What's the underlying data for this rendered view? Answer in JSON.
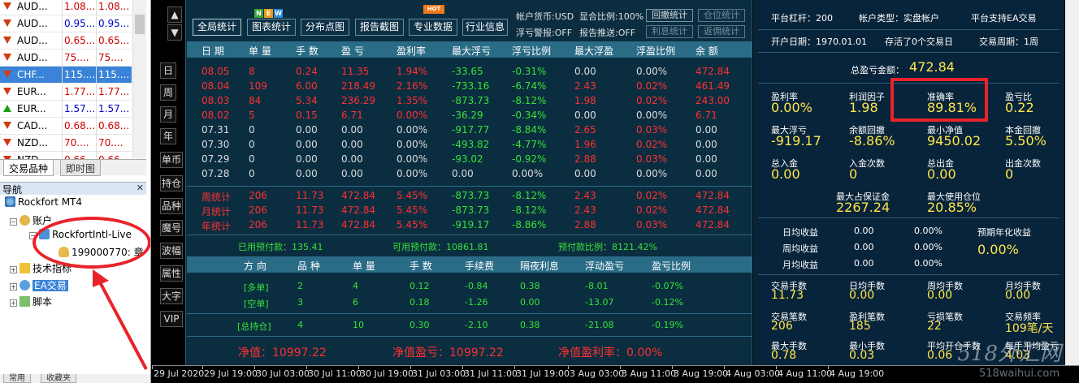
{
  "market_watch": {
    "rows": [
      {
        "symbol": "AUD...",
        "bid": "1.08...",
        "ask": "1.08...",
        "dir": "down",
        "color": "red"
      },
      {
        "symbol": "AUD...",
        "bid": "0.95...",
        "ask": "0.95...",
        "dir": "down",
        "color": "blue"
      },
      {
        "symbol": "AUD...",
        "bid": "0.65...",
        "ask": "0.65...",
        "dir": "down",
        "color": "red"
      },
      {
        "symbol": "AUD...",
        "bid": "75....",
        "ask": "75....",
        "dir": "down",
        "color": "red"
      },
      {
        "symbol": "CHF...",
        "bid": "115....",
        "ask": "115....",
        "dir": "down",
        "color": "sel"
      },
      {
        "symbol": "EUR...",
        "bid": "1.77...",
        "ask": "1.77...",
        "dir": "down",
        "color": "red"
      },
      {
        "symbol": "EUR...",
        "bid": "1.57...",
        "ask": "1.57...",
        "dir": "up",
        "color": "blue"
      },
      {
        "symbol": "CAD...",
        "bid": "0.68...",
        "ask": "0.68...",
        "dir": "down",
        "color": "red"
      },
      {
        "symbol": "NZD...",
        "bid": "70....",
        "ask": "70....",
        "dir": "down",
        "color": "red"
      },
      {
        "symbol": "NZD",
        "bid": "0.66",
        "ask": "0.66",
        "dir": "down",
        "color": "red"
      }
    ],
    "tabs": [
      "交易品种",
      "即时图"
    ]
  },
  "navigator": {
    "title": "导航",
    "root": "Rockfort MT4",
    "accounts": "账户",
    "server": "RockfortIntl-Live",
    "account": "199000770: 章",
    "indicators": "技术指标",
    "ea": "EA交易",
    "scripts": "脚本",
    "bottom_tabs": [
      "常用",
      "收藏夹"
    ]
  },
  "side_buttons": {
    "up": "▲",
    "down": "▼",
    "items": [
      "日",
      "周",
      "月",
      "年",
      "单币",
      "持仓",
      "品种",
      "魔号",
      "波幅",
      "属性",
      "大字",
      "VIP"
    ]
  },
  "toolbar": {
    "buttons": [
      "全局统计",
      "图表统计",
      "分布点图",
      "报告截图",
      "专业数据",
      "行业信息"
    ],
    "new_badges": [
      "N",
      "E",
      "W"
    ],
    "hot": "HOT",
    "currency": "帐户货币:USD",
    "show_ratio": "显合比例:100%",
    "float_alarm": "浮亏警报:OFF",
    "report_push": "报告推送:OFF",
    "btn_drawdown": "回撤统计",
    "btn_position": "仓位统计",
    "btn_interest": "利息统计",
    "btn_rebate": "返佣统计"
  },
  "table1": {
    "headers": [
      "日 期",
      "单 量",
      "手 数",
      "盈 亏",
      "盈利率",
      "最大浮亏",
      "浮亏比例",
      "最大浮盈",
      "浮盈比例",
      "余 额"
    ],
    "rows": [
      {
        "c": "r",
        "v": [
          "08.05",
          "8",
          "0.24",
          "11.35",
          "1.94%",
          "-33.65",
          "-0.31%",
          "0.00",
          "0.00%",
          "472.84"
        ]
      },
      {
        "c": "r",
        "v": [
          "08.04",
          "109",
          "6.00",
          "218.49",
          "2.16%",
          "-733.16",
          "-6.74%",
          "2.43",
          "0.02%",
          "461.49"
        ]
      },
      {
        "c": "r",
        "v": [
          "08.03",
          "84",
          "5.34",
          "236.29",
          "1.35%",
          "-873.73",
          "-8.12%",
          "1.98",
          "0.02%",
          "243.00"
        ]
      },
      {
        "c": "r",
        "v": [
          "08.02",
          "5",
          "0.15",
          "6.71",
          "0.00%",
          "-36.29",
          "-0.34%",
          "0.00",
          "0.00%",
          "6.71"
        ]
      },
      {
        "c": "w",
        "v": [
          "07.31",
          "0",
          "0.00",
          "0.00",
          "0.00%",
          "-917.77",
          "-8.84%",
          "2.65",
          "0.03%",
          "0.00"
        ]
      },
      {
        "c": "w",
        "v": [
          "07.30",
          "0",
          "0.00",
          "0.00",
          "0.00%",
          "-493.82",
          "-4.77%",
          "1.96",
          "0.02%",
          "0.00"
        ]
      },
      {
        "c": "w",
        "v": [
          "07.29",
          "0",
          "0.00",
          "0.00",
          "0.00%",
          "-93.02",
          "-0.92%",
          "2.88",
          "0.03%",
          "0.00"
        ]
      },
      {
        "c": "w",
        "v": [
          "07.28",
          "0",
          "0.00",
          "0.00",
          "0.00%",
          "0.00",
          "0.00%",
          "0.00",
          "0.00%",
          "0.00"
        ]
      }
    ],
    "summary": [
      {
        "v": [
          "周统计",
          "206",
          "11.73",
          "472.84",
          "5.45%",
          "-873.73",
          "-8.12%",
          "2.43",
          "0.02%",
          "472.84"
        ]
      },
      {
        "v": [
          "月统计",
          "206",
          "11.73",
          "472.84",
          "5.45%",
          "-873.73",
          "-8.12%",
          "2.43",
          "0.02%",
          "472.84"
        ]
      },
      {
        "v": [
          "年统计",
          "206",
          "11.73",
          "472.84",
          "5.45%",
          "-919.17",
          "-8.86%",
          "2.88",
          "0.03%",
          "472.84"
        ]
      }
    ],
    "margin_used": "已用预付款：135.41",
    "margin_free": "可用预付款：10861.81",
    "margin_ratio": "预付款比例：8121.42%"
  },
  "table2": {
    "headers": [
      "方 向",
      "品 种",
      "单 量",
      "手 数",
      "手续费",
      "隔夜利息",
      "浮动盈亏",
      "盈亏比例"
    ],
    "rows": [
      {
        "v": [
          "[多单]",
          "2",
          "4",
          "0.12",
          "-0.84",
          "0.38",
          "-8.01",
          "-0.07%"
        ]
      },
      {
        "v": [
          "[空单]",
          "3",
          "6",
          "0.18",
          "-1.26",
          "0.00",
          "-13.07",
          "-0.12%"
        ]
      },
      {
        "v": [
          "[总持仓]",
          "4",
          "10",
          "0.30",
          "-2.10",
          "0.38",
          "-21.08",
          "-0.19%"
        ]
      }
    ]
  },
  "bottom_stats": {
    "equity": "净值：10997.22",
    "equity_pnl": "净值盈亏：10997.22",
    "equity_rate": "净值盈利率：0.00%"
  },
  "right": {
    "leverage": "平台杠杆：200",
    "acct_type": "帐户类型：实盘帐户",
    "ea_support": "平台支持EA交易",
    "open_date": "开户日期：1970.01.01",
    "survive": "存活了0个交易日",
    "cycle": "交易周期：1周",
    "total_pnl_label": "总盈亏金额：",
    "total_pnl": "472.84",
    "s1_labels": [
      "盈利率",
      "利润因子",
      "准确率",
      "盈亏比"
    ],
    "s1_values": [
      "0.00%",
      "1.98",
      "89.81%",
      "0.22"
    ],
    "s2_labels": [
      "最大浮亏",
      "余额回撤",
      "最小净值",
      "本金回撤"
    ],
    "s2_values": [
      "-919.17",
      "-8.86%",
      "9450.02",
      "5.50%"
    ],
    "s3_labels": [
      "总入金",
      "入金次数",
      "总出金",
      "出金次数"
    ],
    "s3_values": [
      "0.00",
      "0",
      "0.00",
      "0"
    ],
    "s4_labels": [
      "最大占保证金",
      "最大使用仓位"
    ],
    "s4_values": [
      "2267.24",
      "20.85%"
    ],
    "avg_labels": [
      "日均收益",
      "周均收益",
      "月均收益"
    ],
    "avg_v1": [
      "0.00",
      "0.00",
      "0.00"
    ],
    "avg_v2": [
      "0.00%",
      "0.00%",
      "0.00%"
    ],
    "annual_label": "预期年化收益",
    "annual_value": "0.00%",
    "s5_labels": [
      "交易手数",
      "日均手数",
      "周均手数",
      "月均手数"
    ],
    "s5_values": [
      "11.73",
      "0.00",
      "0.00",
      "0.00"
    ],
    "s6_labels": [
      "交易笔数",
      "盈利笔数",
      "亏损笔数",
      "交易频率"
    ],
    "s6_values": [
      "206",
      "185",
      "22",
      "109笔/天"
    ],
    "s7_labels": [
      "最大手数",
      "最小手数",
      "平均开仓手数",
      "每手平均盈亏"
    ],
    "s7_values": [
      "0.78",
      "0.03",
      "0.06",
      "4.03"
    ]
  },
  "axis": {
    "ticks": [
      "29 Jul 2020",
      "29 Jul 19:00",
      "30 Jul 03:00",
      "30 Jul 11:00",
      "30 Jul 19:00",
      "31 Jul 03:00",
      "31 Jul 11:00",
      "31 Jul 19:00",
      "3 Aug 03:00",
      "3 Aug 11:00",
      "3 Aug 19:00",
      "4 Aug 03:00",
      "4 Aug 11:00",
      "4 Aug 19:00"
    ]
  },
  "watermark": "518外汇网",
  "watermark_url": "518waihui.com"
}
